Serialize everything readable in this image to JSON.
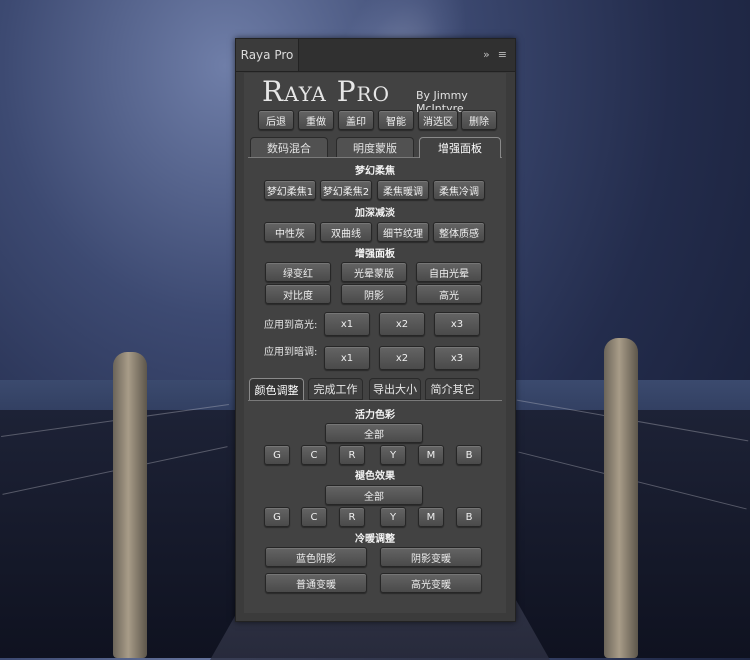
{
  "panel": {
    "tab_title": "Raya Pro",
    "header_icons": [
      "collapse-icon",
      "menu-icon"
    ],
    "brand": "Raya Pro",
    "byline": "By Jimmy McIntyre"
  },
  "top_actions": [
    "后退",
    "重做",
    "盖印",
    "智能",
    "消选区",
    "删除"
  ],
  "tabs": [
    "数码混合",
    "明度蒙版",
    "增强面板"
  ],
  "active_tab": "增强面板",
  "enhance": {
    "dream_title": "梦幻柔焦",
    "dream_buttons": [
      "梦幻柔焦1",
      "梦幻柔焦2",
      "柔焦暖调",
      "柔焦冷调"
    ],
    "dodge_title": "加深减淡",
    "dodge_buttons": [
      "中性灰",
      "双曲线",
      "细节纹理",
      "整体质感"
    ],
    "panel_title": "增强面板",
    "panel_buttons_row1": [
      "绿变红",
      "光晕蒙版",
      "自由光晕"
    ],
    "panel_buttons_row2": [
      "对比度",
      "阴影",
      "高光"
    ],
    "highlight_label": "应用到高光:",
    "shadow_label": "应用到暗调:",
    "multipliers": [
      "x1",
      "x2",
      "x3"
    ]
  },
  "lower_tabs": [
    "颜色调整",
    "完成工作",
    "导出大小",
    "简介其它"
  ],
  "active_lower_tab": "颜色调整",
  "color": {
    "vibrance_title": "活力色彩",
    "all_label": "全部",
    "channels": [
      "G",
      "C",
      "R",
      "Y",
      "M",
      "B"
    ],
    "tint_title": "褪色效果",
    "warmcool_title": "冷暖调整",
    "warmcool_row1": [
      "蓝色阴影",
      "阴影变暖"
    ],
    "warmcool_row2": [
      "普通变暖",
      "高光变暖"
    ]
  },
  "colors": {
    "panel_bg": "#3b3b3b",
    "button_bg": "#555555",
    "text": "#f0f0f0"
  }
}
